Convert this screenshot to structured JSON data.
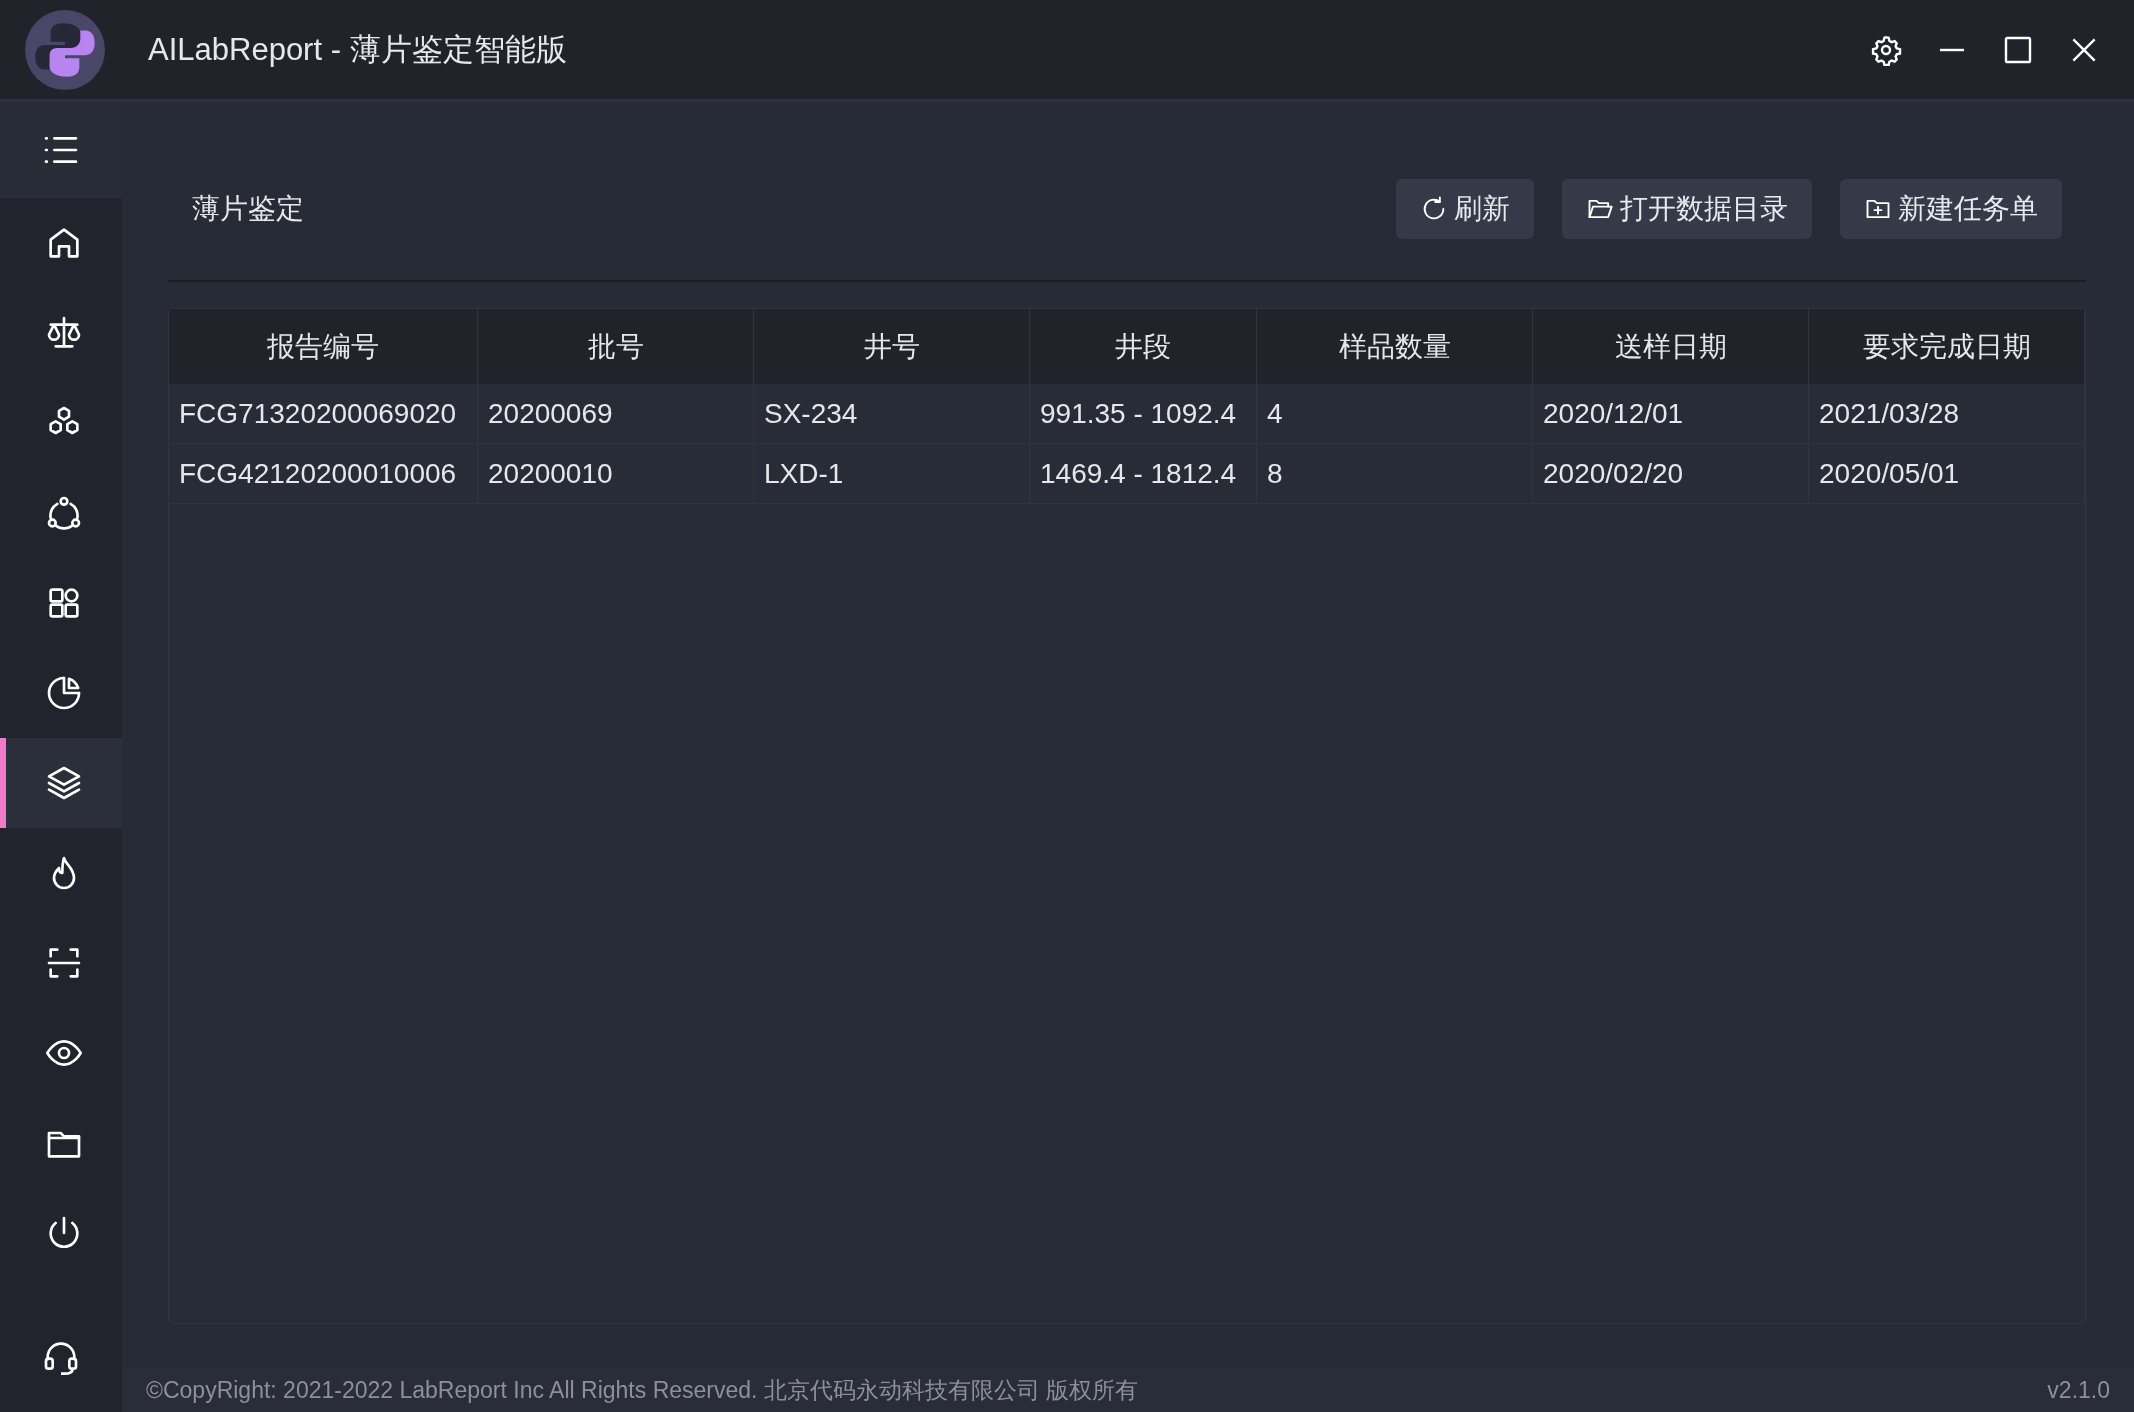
{
  "window": {
    "title": "AILabReport - 薄片鉴定智能版"
  },
  "sidebar": {
    "items": [
      {
        "kind": "home",
        "selected": false
      },
      {
        "kind": "scale",
        "selected": false
      },
      {
        "kind": "hexagons",
        "selected": false
      },
      {
        "kind": "nodes",
        "selected": false
      },
      {
        "kind": "grid",
        "selected": false
      },
      {
        "kind": "pie",
        "selected": false
      },
      {
        "kind": "layers",
        "selected": true
      },
      {
        "kind": "flame",
        "selected": false
      },
      {
        "kind": "scan",
        "selected": false
      },
      {
        "kind": "eye",
        "selected": false
      },
      {
        "kind": "folder",
        "selected": false
      },
      {
        "kind": "power",
        "selected": false
      }
    ]
  },
  "page": {
    "title": "薄片鉴定",
    "buttons": [
      {
        "kind": "refresh",
        "label": "刷新"
      },
      {
        "kind": "open",
        "label": "打开数据目录"
      },
      {
        "kind": "create",
        "label": "新建任务单"
      }
    ]
  },
  "table": {
    "columns": [
      "报告编号",
      "批号",
      "井号",
      "井段",
      "样品数量",
      "送样日期",
      "要求完成日期"
    ],
    "rows": [
      [
        "FCG71320200069020",
        "20200069",
        "SX-234",
        "991.35 - 1092.4",
        "4",
        "2020/12/01",
        "2021/03/28"
      ],
      [
        "FCG42120200010006",
        "20200010",
        "LXD-1",
        "1469.4 - 1812.4",
        "8",
        "2020/02/20",
        "2020/05/01"
      ]
    ]
  },
  "status_bar": {
    "copyright": "©CopyRight: 2021-2022 LabReport Inc All Rights Reserved. 北京代码永动科技有限公司 版权所有",
    "version": "v2.1.0"
  }
}
